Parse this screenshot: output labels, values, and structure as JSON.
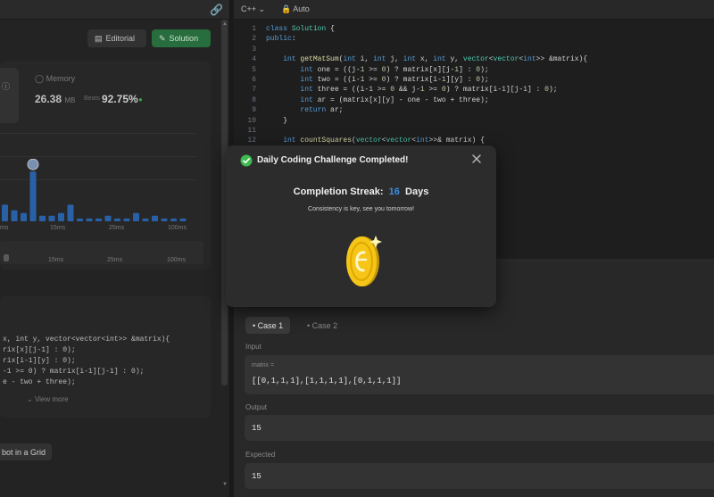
{
  "left_panel": {
    "buttons": {
      "editorial": "Editorial",
      "solution": "Solution"
    },
    "memory": {
      "label": "Memory",
      "value": "26.38",
      "unit": "MB",
      "beats_label": "Beats",
      "beats_value": "92.75%"
    },
    "x_ticks": [
      "ms",
      "15ms",
      "25ms",
      "100ms"
    ],
    "slider_ticks": [
      "15ms",
      "25ms",
      "100ms"
    ],
    "code_preview": [
      "x, int y, vector<vector<int>> &matrix){",
      "rix[x][j-1] : 0);",
      "rix[i-1][y] : 0);",
      "-1 >= 0) ? matrix[i-1][j-1] : 0);",
      "e - two + three);"
    ],
    "view_more": "View more",
    "tag": "bot in a Grid"
  },
  "editor": {
    "language": "C++",
    "mode": "Auto",
    "lines": [
      {
        "n": "1",
        "text": "class Solution {"
      },
      {
        "n": "2",
        "text": "public:"
      },
      {
        "n": "3",
        "text": ""
      },
      {
        "n": "4",
        "text": "    int getMatSum(int i, int j, int x, int y, vector<vector<int>> &matrix){"
      },
      {
        "n": "5",
        "text": "        int one = ((j-1 >= 0) ? matrix[x][j-1] : 0);"
      },
      {
        "n": "6",
        "text": "        int two = ((i-1 >= 0) ? matrix[i-1][y] : 0);"
      },
      {
        "n": "7",
        "text": "        int three = ((i-1 >= 0 && j-1 >= 0) ? matrix[i-1][j-1] : 0);"
      },
      {
        "n": "8",
        "text": "        int ar = (matrix[x][y] - one - two + three);"
      },
      {
        "n": "9",
        "text": "        return ar;"
      },
      {
        "n": "10",
        "text": "    }"
      },
      {
        "n": "11",
        "text": ""
      },
      {
        "n": "12",
        "text": "    int countSquares(vector<vector<int>>& matrix) {"
      }
    ]
  },
  "testcase": {
    "tabs": [
      "Case 1",
      "Case 2"
    ],
    "input_label": "Input",
    "input_var": "matrix =",
    "input_value": "[[0,1,1,1],[1,1,1,1],[0,1,1,1]]",
    "output_label": "Output",
    "output_value": "15",
    "expected_label": "Expected",
    "expected_value": "15"
  },
  "modal": {
    "title": "Daily Coding Challenge Completed!",
    "streak_prefix": "Completion Streak:",
    "streak_number": "16",
    "streak_suffix": "Days",
    "message": "Consistency is key, see you tomorrow!",
    "accent_color": "#3a8fe0",
    "check_color": "#3fb950"
  },
  "chart_data": {
    "type": "bar",
    "values": [
      6,
      4,
      3,
      18,
      2,
      2,
      3,
      6,
      1,
      1,
      1,
      2,
      1,
      1,
      3,
      1,
      2,
      1,
      1,
      1
    ],
    "highlight_index": 3
  }
}
